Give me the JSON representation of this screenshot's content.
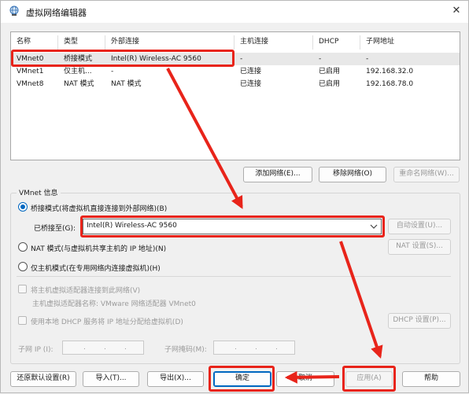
{
  "window": {
    "title": "虚拟网络编辑器",
    "close_glyph": "✕"
  },
  "table": {
    "columns": [
      "名称",
      "类型",
      "外部连接",
      "主机连接",
      "DHCP",
      "子网地址"
    ],
    "rows": [
      {
        "name": "VMnet0",
        "type": "桥接模式",
        "external": "Intel(R) Wireless-AC 9560",
        "host": "-",
        "dhcp": "-",
        "subnet": "-",
        "selected": true
      },
      {
        "name": "VMnet1",
        "type": "仅主机...",
        "external": "-",
        "host": "已连接",
        "dhcp": "已启用",
        "subnet": "192.168.32.0",
        "selected": false
      },
      {
        "name": "VMnet8",
        "type": "NAT 模式",
        "external": "NAT 模式",
        "host": "已连接",
        "dhcp": "已启用",
        "subnet": "192.168.78.0",
        "selected": false
      }
    ]
  },
  "table_buttons": {
    "add": "添加网络(E)...",
    "remove": "移除网络(O)",
    "rename": "重命名网络(W)..."
  },
  "info": {
    "group_label": "VMnet 信息",
    "bridged_radio": "桥接模式(将虚拟机直接连接到外部网络)(B)",
    "bridged_to_label": "已桥接至(G):",
    "bridged_to_value": "Intel(R) Wireless-AC 9560",
    "auto_settings": "自动设置(U)...",
    "nat_radio": "NAT 模式(与虚拟机共享主机的 IP 地址)(N)",
    "nat_settings": "NAT 设置(S)...",
    "hostonly_radio": "仅主机模式(在专用网络内连接虚拟机)(H)",
    "connect_adapter": "将主机虚拟适配器连接到此网络(V)",
    "adapter_name": "主机虚拟适配器名称: VMware 网络适配器 VMnet0",
    "use_dhcp": "使用本地 DHCP 服务将 IP 地址分配给虚拟机(D)",
    "dhcp_settings": "DHCP 设置(P)...",
    "subnet_ip_label": "子网 IP (I):",
    "subnet_mask_label": "子网掩码(M):",
    "ip_dot": "."
  },
  "footer": {
    "restore": "还原默认设置(R)",
    "import": "导入(T)...",
    "export": "导出(X)...",
    "ok": "确定",
    "cancel": "取消",
    "apply": "应用(A)",
    "help": "帮助"
  },
  "colors": {
    "annotation_red": "#e8241a",
    "accent": "#0067c0"
  }
}
